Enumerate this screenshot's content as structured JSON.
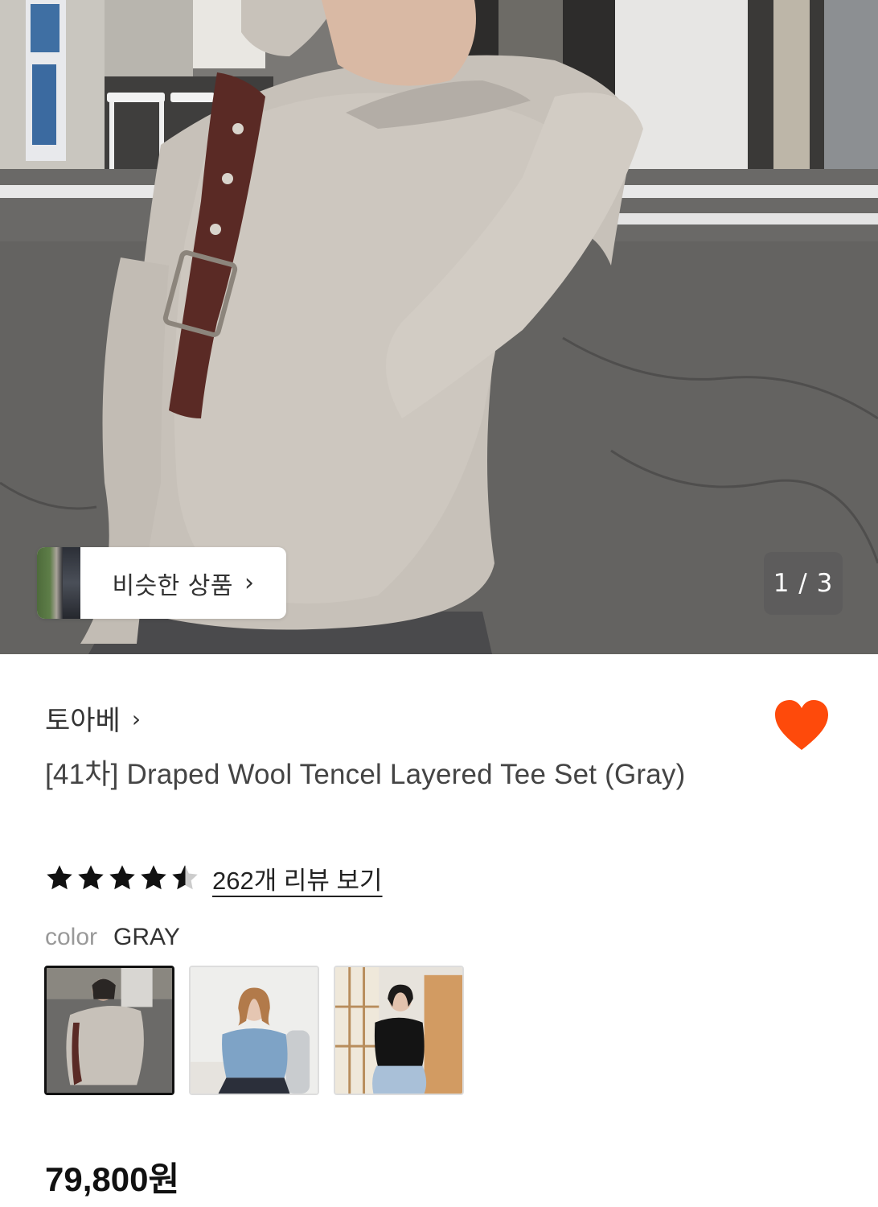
{
  "gallery": {
    "current_page": 1,
    "total_pages": 3,
    "counter_text": "1 / 3",
    "similar_button_label": "비슷한 상품",
    "similar_button_chevron": "›"
  },
  "product": {
    "brand": "토아베",
    "brand_chevron": "›",
    "title": "[41차] Draped Wool Tencel Layered Tee Set (Gray)",
    "rating": 4.5,
    "review_link": "262개 리뷰 보기",
    "color_label": "color",
    "color_value": "GRAY",
    "price": "79,800원",
    "liked": true,
    "swatches": [
      {
        "name": "gray",
        "selected": true
      },
      {
        "name": "blue",
        "selected": false
      },
      {
        "name": "black",
        "selected": false
      }
    ]
  },
  "colors": {
    "heart": "#fe4a0b",
    "text_primary": "#111111",
    "text_muted": "#999999",
    "counter_bg": "#5a5a5a"
  },
  "icons": {
    "heart": "heart-icon",
    "star_full": "star-icon",
    "star_half": "star-half-icon",
    "chevron": "chevron-right-icon"
  }
}
